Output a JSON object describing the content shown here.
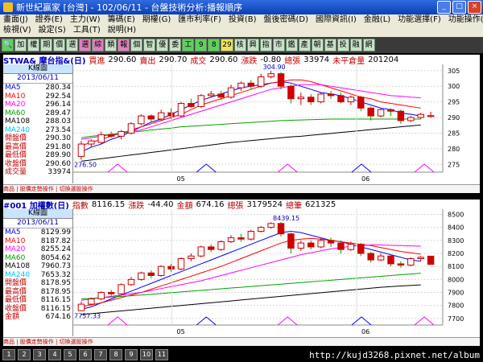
{
  "window": {
    "title": "新世紀贏家 [台灣] - 102/06/11 - 台盤技術分析:播報順序"
  },
  "menu": {
    "row1": [
      "畫面(J)",
      "證券(E)",
      "主力(W)",
      "籌碼(E)",
      "期權(G)",
      "匯市利率(F)",
      "投資(B)",
      "盤後密碼(D)",
      "國際資訊(I)",
      "金融(L)",
      "功能選擇(F)",
      "功能操作(F)"
    ],
    "row2": [
      "檢視(V)",
      "設定(S)",
      "工具(T)",
      "說明(H)"
    ]
  },
  "toolbar": [
    "加",
    "權",
    "期",
    "價",
    "選",
    "選",
    "綜",
    "類",
    "報",
    "個",
    "智",
    "優",
    "委",
    "工",
    "9",
    "8",
    "29",
    "核",
    "興",
    "指",
    "市",
    "鑑",
    "產",
    "朝",
    "基",
    "投",
    "融",
    "網"
  ],
  "top": {
    "symbol": "STWA& 摩台指&(日)",
    "fields": [
      {
        "label": "買進",
        "value": "290.60"
      },
      {
        "label": "賣出",
        "value": "290.70"
      },
      {
        "label": "成交",
        "value": "290.60"
      },
      {
        "label": "漲跌",
        "value": "-0.80"
      },
      {
        "label": "總張",
        "value": "33974"
      },
      {
        "label": "未平倉量",
        "value": "201204"
      }
    ],
    "ktype": "K線圖",
    "date": "2013/06/11",
    "legend": [
      {
        "name": "MA5",
        "value": "280.34",
        "color": "#0000ff"
      },
      {
        "name": "MA10",
        "value": "292.54",
        "color": "#ff0000"
      },
      {
        "name": "MA20",
        "value": "296.14",
        "color": "#ff00ff"
      },
      {
        "name": "MA60",
        "value": "289.47",
        "color": "#00a000"
      },
      {
        "name": "MA108",
        "value": "288.03",
        "color": "#000000"
      },
      {
        "name": "MA240",
        "value": "273.54",
        "color": "#00c0ff"
      },
      {
        "name": "開盤價",
        "value": "290.30",
        "color": "#c00000"
      },
      {
        "name": "最高價",
        "value": "291.80",
        "color": "#c00000"
      },
      {
        "name": "最低價",
        "value": "289.90",
        "color": "#c00000"
      },
      {
        "name": "收盤價",
        "value": "290.60",
        "color": "#c00000"
      },
      {
        "name": "成交量",
        "value": "33974",
        "color": "#c00000"
      }
    ],
    "ymin": 272.5,
    "ymax": 307,
    "yticks": [
      305,
      300,
      295,
      290,
      285,
      280,
      275
    ],
    "hi_label": "304.90",
    "lo_label": "276.50",
    "months": [
      "05",
      "06"
    ],
    "status": "商品 | 股價走勢操作 | 切換選股操作",
    "candles": [
      [
        277.5,
        281.5,
        276.5,
        282.5
      ],
      [
        281.5,
        282.5,
        280.5,
        283
      ],
      [
        282,
        284.5,
        281.5,
        285.5
      ],
      [
        284.5,
        284,
        283.5,
        285.5
      ],
      [
        284,
        285.5,
        283,
        286
      ],
      [
        285,
        288,
        284.5,
        288.5
      ],
      [
        288,
        290.5,
        287.5,
        291
      ],
      [
        290.5,
        289.5,
        288.5,
        291
      ],
      [
        289.5,
        291.5,
        289,
        292.5
      ],
      [
        291.5,
        290.5,
        289.5,
        293
      ],
      [
        290.5,
        294.5,
        290,
        295
      ],
      [
        294.5,
        293.5,
        293,
        296
      ],
      [
        293.5,
        297,
        293,
        297.5
      ],
      [
        297,
        297.5,
        296.5,
        298.5
      ],
      [
        297.5,
        296.5,
        295.5,
        298.5
      ],
      [
        296.5,
        299.5,
        296,
        300.5
      ],
      [
        299.5,
        301,
        298.5,
        301.5
      ],
      [
        301,
        300,
        299,
        302
      ],
      [
        300,
        303,
        299.5,
        304
      ],
      [
        303,
        304,
        302.5,
        304.9
      ],
      [
        304,
        300,
        299,
        304.5
      ],
      [
        300,
        296,
        294.5,
        300.5
      ],
      [
        296,
        296.5,
        294,
        298
      ],
      [
        296.5,
        295,
        294,
        297.5
      ],
      [
        295,
        297.5,
        294.5,
        298
      ],
      [
        297.5,
        297,
        296,
        298.5
      ],
      [
        297,
        295,
        294.5,
        298
      ],
      [
        295,
        296.5,
        294,
        297
      ],
      [
        296.5,
        293,
        292,
        297
      ],
      [
        293,
        290.5,
        289,
        293.5
      ],
      [
        290.5,
        292.5,
        290,
        293
      ],
      [
        292.5,
        292,
        290.5,
        293
      ],
      [
        292,
        289,
        288,
        292.5
      ],
      [
        289,
        290,
        288.5,
        290.5
      ],
      [
        290,
        291,
        289.5,
        291.5
      ],
      [
        290.3,
        290.6,
        289.9,
        291.8
      ]
    ],
    "ma5": [
      279,
      280.5,
      281.5,
      283,
      284,
      285.5,
      287,
      288.5,
      289.5,
      291,
      292.5,
      294,
      295.5,
      296.5,
      297.5,
      298.5,
      299.5,
      300,
      300.5,
      301,
      301.5,
      301,
      300,
      299,
      298,
      297.5,
      297,
      296,
      295,
      294,
      293,
      292.5,
      291.5,
      291,
      290.5,
      280.34
    ],
    "ma10": [
      281,
      282,
      283,
      284,
      285,
      286,
      287,
      288,
      289,
      290,
      291,
      292.5,
      294,
      295,
      296,
      297,
      298,
      299,
      300,
      301,
      301.5,
      302,
      302,
      301.5,
      300.5,
      299.5,
      298.5,
      297.5,
      296.5,
      296,
      295,
      294.5,
      294,
      293.5,
      293,
      292.54
    ],
    "ma20": [
      283,
      283.5,
      284,
      284.5,
      285,
      285.5,
      286,
      287,
      288,
      289,
      290,
      291,
      292,
      293,
      294,
      295,
      296,
      297,
      298,
      299,
      299.5,
      300,
      300.5,
      300.5,
      300.5,
      300,
      299.5,
      299,
      298.5,
      298,
      297.5,
      297,
      296.8,
      296.5,
      296.3,
      296.14
    ],
    "ma60": [
      283.5,
      284,
      284.3,
      284.6,
      285,
      285.3,
      285.6,
      286,
      286.3,
      286.6,
      287,
      287.2,
      287.4,
      287.6,
      287.8,
      288,
      288.2,
      288.4,
      288.6,
      288.8,
      289,
      289.1,
      289.2,
      289.3,
      289.4,
      289.5,
      289.5,
      289.5,
      289.5,
      289.5,
      289.5,
      289.5,
      289.5,
      289.5,
      289.5,
      289.47
    ],
    "ma108": [
      276,
      276.4,
      276.8,
      277.2,
      277.6,
      278,
      278.4,
      278.8,
      279.2,
      279.6,
      280,
      280.4,
      280.8,
      281.2,
      281.6,
      282,
      282.3,
      282.6,
      282.9,
      283.2,
      283.5,
      283.8,
      284,
      284.3,
      284.6,
      284.9,
      285.2,
      285.5,
      285.8,
      286.1,
      286.4,
      286.7,
      287,
      287.3,
      287.6,
      288.03
    ]
  },
  "bottom": {
    "symbol": "#001 加權數(日)",
    "fields": [
      {
        "label": "指數",
        "value": "8116.15"
      },
      {
        "label": "漲跌",
        "value": "-44.40"
      },
      {
        "label": "金額",
        "value": "674.16"
      },
      {
        "label": "總張",
        "value": "3179524"
      },
      {
        "label": "總筆",
        "value": "621325"
      }
    ],
    "ktype": "K線圖",
    "date": "2013/06/11",
    "legend": [
      {
        "name": "MA5",
        "value": "8129.99",
        "color": "#0000ff"
      },
      {
        "name": "MA10",
        "value": "8187.82",
        "color": "#ff0000"
      },
      {
        "name": "MA20",
        "value": "8255.24",
        "color": "#ff00ff"
      },
      {
        "name": "MA60",
        "value": "8054.62",
        "color": "#00a000"
      },
      {
        "name": "MA108",
        "value": "7960.73",
        "color": "#000000"
      },
      {
        "name": "MA240",
        "value": "7653.32",
        "color": "#00c0ff"
      },
      {
        "name": "開盤價",
        "value": "8178.95",
        "color": "#c00000"
      },
      {
        "name": "最高價",
        "value": "8178.95",
        "color": "#c00000"
      },
      {
        "name": "最低價",
        "value": "8116.15",
        "color": "#c00000"
      },
      {
        "name": "收盤價",
        "value": "8116.15",
        "color": "#c00000"
      },
      {
        "name": "金額",
        "value": "674.16",
        "color": "#c00000"
      }
    ],
    "ymin": 7650,
    "ymax": 8540,
    "yticks": [
      8500,
      8400,
      8300,
      8200,
      8100,
      8000,
      7900,
      7800,
      7700
    ],
    "hi_label": "8439.15",
    "lo_label": "7757.33",
    "months": [
      "05",
      "06"
    ],
    "status": "商品 | 股價走勢操作 | 切換選股操作",
    "candles": [
      [
        7760,
        7810,
        7757,
        7830
      ],
      [
        7810,
        7850,
        7800,
        7860
      ],
      [
        7850,
        7900,
        7840,
        7910
      ],
      [
        7900,
        7890,
        7870,
        7920
      ],
      [
        7890,
        7960,
        7880,
        7970
      ],
      [
        7960,
        8000,
        7950,
        8020
      ],
      [
        8000,
        8050,
        7990,
        8060
      ],
      [
        8050,
        8030,
        8010,
        8070
      ],
      [
        8030,
        8100,
        8020,
        8110
      ],
      [
        8100,
        8080,
        8060,
        8120
      ],
      [
        8080,
        8160,
        8070,
        8170
      ],
      [
        8160,
        8180,
        8140,
        8200
      ],
      [
        8180,
        8250,
        8170,
        8260
      ],
      [
        8250,
        8230,
        8210,
        8270
      ],
      [
        8230,
        8290,
        8220,
        8300
      ],
      [
        8290,
        8320,
        8280,
        8340
      ],
      [
        8320,
        8310,
        8290,
        8350
      ],
      [
        8310,
        8370,
        8300,
        8380
      ],
      [
        8370,
        8400,
        8360,
        8410
      ],
      [
        8400,
        8430,
        8390,
        8439
      ],
      [
        8430,
        8350,
        8330,
        8440
      ],
      [
        8350,
        8240,
        8200,
        8360
      ],
      [
        8240,
        8280,
        8220,
        8300
      ],
      [
        8280,
        8250,
        8230,
        8300
      ],
      [
        8250,
        8300,
        8240,
        8320
      ],
      [
        8300,
        8280,
        8250,
        8320
      ],
      [
        8280,
        8230,
        8200,
        8300
      ],
      [
        8230,
        8270,
        8220,
        8290
      ],
      [
        8270,
        8200,
        8180,
        8280
      ],
      [
        8200,
        8150,
        8130,
        8210
      ],
      [
        8150,
        8180,
        8140,
        8200
      ],
      [
        8180,
        8120,
        8100,
        8190
      ],
      [
        8120,
        8110,
        8090,
        8140
      ],
      [
        8110,
        8160,
        8100,
        8170
      ],
      [
        8160,
        8170,
        8140,
        8180
      ],
      [
        8179,
        8116,
        8116,
        8179
      ]
    ],
    "ma5": [
      7770,
      7790,
      7820,
      7850,
      7880,
      7910,
      7940,
      7970,
      8000,
      8030,
      8060,
      8090,
      8120,
      8150,
      8180,
      8210,
      8240,
      8270,
      8300,
      8330,
      8360,
      8370,
      8360,
      8340,
      8320,
      8300,
      8290,
      8270,
      8250,
      8230,
      8210,
      8190,
      8170,
      8150,
      8140,
      8129.99
    ],
    "ma10": [
      7790,
      7805,
      7820,
      7840,
      7860,
      7880,
      7900,
      7925,
      7950,
      7975,
      8000,
      8025,
      8050,
      8075,
      8100,
      8130,
      8160,
      8190,
      8220,
      8250,
      8280,
      8300,
      8310,
      8315,
      8310,
      8300,
      8290,
      8280,
      8270,
      8260,
      8245,
      8230,
      8215,
      8205,
      8195,
      8187.82
    ],
    "ma20": [
      7840,
      7850,
      7860,
      7870,
      7880,
      7890,
      7900,
      7915,
      7930,
      7945,
      7960,
      7975,
      7990,
      8010,
      8030,
      8050,
      8070,
      8090,
      8110,
      8130,
      8150,
      8170,
      8190,
      8205,
      8220,
      8235,
      8245,
      8255,
      8260,
      8265,
      8265,
      8262,
      8260,
      8258,
      8256,
      8255.24
    ],
    "ma60": [
      7850,
      7855,
      7860,
      7865,
      7870,
      7875,
      7880,
      7886,
      7892,
      7898,
      7904,
      7910,
      7916,
      7922,
      7928,
      7934,
      7940,
      7946,
      7952,
      7958,
      7964,
      7970,
      7976,
      7982,
      7988,
      7994,
      8000,
      8006,
      8012,
      8018,
      8024,
      8030,
      8036,
      8042,
      8048,
      8054.62
    ],
    "ma108": [
      7730,
      7737,
      7744,
      7751,
      7758,
      7765,
      7772,
      7779,
      7786,
      7793,
      7800,
      7807,
      7814,
      7821,
      7828,
      7835,
      7842,
      7849,
      7856,
      7863,
      7870,
      7877,
      7884,
      7891,
      7898,
      7905,
      7912,
      7919,
      7926,
      7933,
      7940,
      7945,
      7950,
      7954,
      7958,
      7960.73
    ]
  },
  "footer": {
    "url": "http://kujd3268.pixnet.net/album",
    "tabs": [
      "1",
      "2",
      "3",
      "4",
      "5",
      "6",
      "7",
      "8",
      "9",
      "10",
      "11"
    ]
  }
}
